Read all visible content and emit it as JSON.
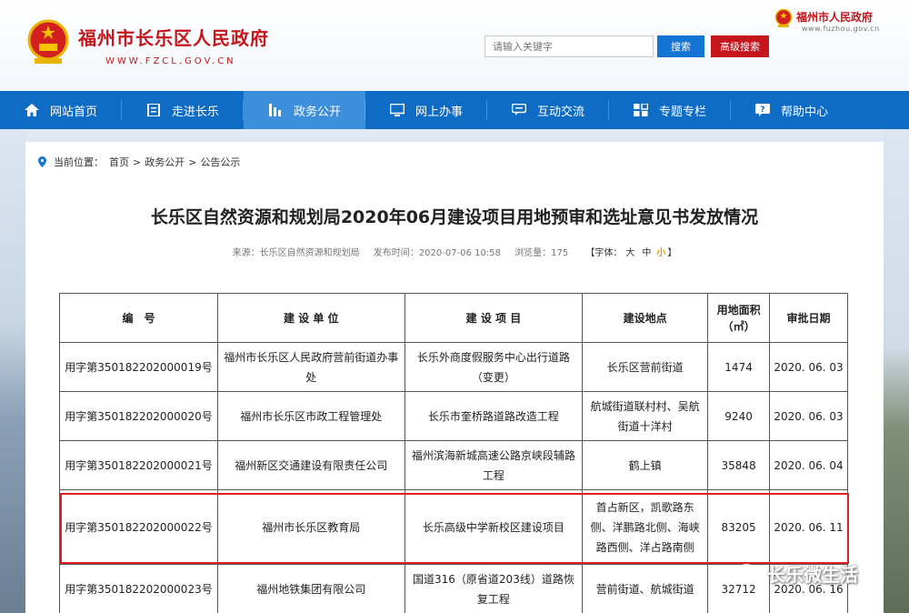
{
  "header": {
    "site_title": "福州市长乐区人民政府",
    "site_url": "WWW.FZCL.GOV.CN",
    "search_placeholder": "请输入关键字",
    "search_label": "搜索",
    "advanced_search_label": "高级搜索",
    "parent_site_title": "福州市人民政府",
    "parent_site_url": "www.fuzhou.gov.cn"
  },
  "nav": [
    {
      "label": "网站首页",
      "icon": "home-icon"
    },
    {
      "label": "走进长乐",
      "icon": "book-icon"
    },
    {
      "label": "政务公开",
      "icon": "chart-icon",
      "active": true
    },
    {
      "label": "网上办事",
      "icon": "monitor-icon"
    },
    {
      "label": "互动交流",
      "icon": "chat-icon"
    },
    {
      "label": "专题专栏",
      "icon": "grid-icon"
    },
    {
      "label": "帮助中心",
      "icon": "question-icon"
    }
  ],
  "breadcrumb": {
    "prefix": "当前位置：",
    "home": "首页",
    "sep1": ">",
    "section": "政务公开",
    "sep2": ">",
    "current": "公告公示"
  },
  "article": {
    "title": "长乐区自然资源和规划局2020年06月建设项目用地预审和选址意见书发放情况",
    "source": "来源：长乐区自然资源和规划局",
    "published": "发布时间：2020-07-06 10:58",
    "views": "浏览量：175",
    "font_label": "【字体：",
    "font_large": "大",
    "font_medium": "中",
    "font_small": "小",
    "font_close": "】"
  },
  "table": {
    "headers": [
      "编　号",
      "建 设 单 位",
      "建 设 项 目",
      "建设地点",
      "用地面积（㎡）",
      "审批日期"
    ],
    "rows": [
      [
        "用字第350182202000019号",
        "福州市长乐区人民政府营前街道办事处",
        "长乐外商度假服务中心出行道路（变更）",
        "长乐区营前街道",
        "1474",
        "2020. 06. 03"
      ],
      [
        "用字第350182202000020号",
        "福州市长乐区市政工程管理处",
        "长乐市奎桥路道路改造工程",
        "航城街道联村村、吴航街道十洋村",
        "9240",
        "2020. 06. 03"
      ],
      [
        "用字第350182202000021号",
        "福州新区交通建设有限责任公司",
        "福州滨海新城高速公路京峡段辅路工程",
        "鹤上镇",
        "35848",
        "2020. 06. 04"
      ],
      [
        "用字第350182202000022号",
        "福州市长乐区教育局",
        "长乐高级中学新校区建设项目",
        "首占新区，凯歌路东侧、洋鹏路北侧、海峡路西侧、洋占路南侧",
        "83205",
        "2020. 06. 11"
      ],
      [
        "用字第350182202000023号",
        "福州地铁集团有限公司",
        "国道316（原省道203线）道路恢复工程",
        "营前街道、航城街道",
        "32712",
        "2020. 06. 16"
      ]
    ]
  },
  "watermark": "长乐微生活",
  "colors": {
    "brand_red": "#c4161c",
    "nav_blue": "#0f6cc5",
    "nav_active": "#3d8fdc",
    "highlight": "#e02020"
  }
}
